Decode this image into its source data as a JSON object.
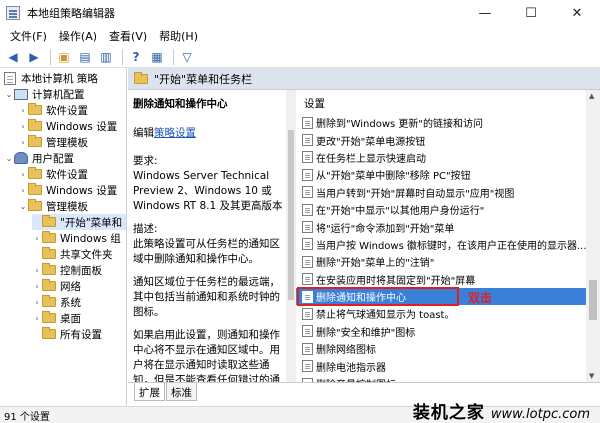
{
  "window": {
    "title": "本地组策略编辑器",
    "controls": {
      "minimize": "—",
      "maximize": "☐",
      "close": "✕"
    }
  },
  "menubar": [
    "文件(F)",
    "操作(A)",
    "查看(V)",
    "帮助(H)"
  ],
  "toolbar": {
    "icons": [
      "back-arrow-icon",
      "forward-arrow-icon",
      "up-folder-icon",
      "show-hide-tree-icon",
      "export-list-icon",
      "help-icon",
      "properties-icon",
      "filter-icon"
    ],
    "glyphs": {
      "back": "◀",
      "forward": "▶",
      "folder": "▣",
      "tree": "▤",
      "export": "▥",
      "help": "?",
      "props": "▦",
      "filter": "▽"
    }
  },
  "tree": {
    "root": "本地计算机 策略",
    "computer_config": "计算机配置",
    "cc_software": "软件设置",
    "cc_windows": "Windows 设置",
    "cc_admin": "管理模板",
    "user_config": "用户配置",
    "uc_software": "软件设置",
    "uc_windows": "Windows 设置",
    "uc_admin": "管理模板",
    "start_taskbar": "\"开始\"菜单和",
    "windows_components": "Windows 组",
    "shared_folders": "共享文件夹",
    "control_panel": "控制面板",
    "network": "网络",
    "system": "系统",
    "desktop": "桌面",
    "all_settings": "所有设置"
  },
  "header": {
    "title": "\"开始\"菜单和任务栏"
  },
  "description": {
    "title": "删除通知和操作中心",
    "edit_prefix": "编辑",
    "edit_link": "策略设置",
    "requirements_label": "要求:",
    "requirements_text": "Windows Server Technical Preview 2、Windows 10 或 Windows RT 8.1 及其更高版本",
    "desc_label": "描述:",
    "desc_text": "此策略设置可从任务栏的通知区域中删除通知和操作中心。",
    "desc_text2": "通知区域位于任务栏的最远端，其中包括当前通知和系统时钟的图标。",
    "desc_text3": "如果启用此设置，则通知和操作中心将不显示在通知区域中。用户将在显示通知时读取这些通知，但是不能查看任何错过的通知。"
  },
  "settings": {
    "header": "设置",
    "items": [
      "删除到\"Windows 更新\"的链接和访问",
      "更改\"开始\"菜单电源按钮",
      "在任务栏上显示快速启动",
      "从\"开始\"菜单中删除\"移除 PC\"按钮",
      "当用户转到\"开始\"屏幕时自动显示\"应用\"视图",
      "在\"开始\"中显示\"以其他用户身份运行\"",
      "将\"运行\"命令添加到\"开始\"菜单",
      "当用户按 Windows 徽标键时，在该用户正在使用的显示器...",
      "删除\"开始\"菜单上的\"注销\"",
      "在安装应用时将其固定到\"开始\"屏幕",
      "删除通知和操作中心",
      "禁止将气球通知显示为 toast。",
      "删除\"安全和维护\"图标",
      "删除网络图标",
      "删除电池指示器",
      "删除音量控制图标"
    ],
    "selected_index": 10,
    "annotation": "双击"
  },
  "tabs": [
    "扩展",
    "标准"
  ],
  "status": "91 个设置",
  "watermark": {
    "cn": "装机之家",
    "url": "www.lotpc.com"
  },
  "colors": {
    "selection": "#3a7fd8",
    "annotation": "#e02020",
    "link": "#1a56b8",
    "header_band": "#dde3ec"
  }
}
